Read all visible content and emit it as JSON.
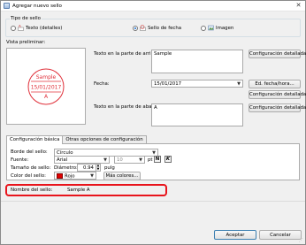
{
  "window": {
    "title": "Agregar nuevo sello"
  },
  "stamp_type": {
    "legend": "Tipo de sello",
    "options": [
      {
        "label": "Texto (detalles)",
        "checked": false,
        "icon": "text-stamp-icon"
      },
      {
        "label": "Sello de fecha",
        "checked": true,
        "icon": "date-stamp-icon"
      },
      {
        "label": "Imagen",
        "checked": false,
        "icon": "image-stamp-icon"
      }
    ]
  },
  "preview": {
    "label": "Vista preliminar:",
    "stamp_top": "Sample",
    "stamp_date": "15/01/2017",
    "stamp_bottom": "A",
    "stamp_color": "#e0303a"
  },
  "fields": {
    "top_text_label": "Texto en la parte de arriba:",
    "top_text_value": "Sample",
    "date_label": "Fecha:",
    "date_value": "15/01/2017",
    "bottom_text_label": "Texto en la parte de abajo:",
    "bottom_text_value": "A",
    "detailed_config": "Configuración detallada...",
    "date_time_button": "Ed. fecha/hora..."
  },
  "tabs": [
    {
      "label": "Configuración básica",
      "active": true
    },
    {
      "label": "Otras opciones de configuración",
      "active": false
    }
  ],
  "basic": {
    "border_label": "Borde del sello:",
    "border_value": "Círculo",
    "size_label": "Tamaño de sello:",
    "diameter_label": "Diámetro:",
    "diameter_value": "0.94",
    "unit": "pulg",
    "font_label": "Fuente:",
    "font_value": "Arial",
    "font_size_value": "10",
    "font_size_unit": "pt",
    "bold_label": "N",
    "italic_label": "K",
    "color_label": "Color del sello:",
    "color_value": "Rojo",
    "color_swatch": "#e00000",
    "more_colors": "Más colores..."
  },
  "stamp_name": {
    "label": "Nombre del sello:",
    "value": "Sample A"
  },
  "buttons": {
    "accept": "Aceptar",
    "cancel": "Cancelar"
  },
  "accent": {
    "highlight": "#e8141c"
  }
}
